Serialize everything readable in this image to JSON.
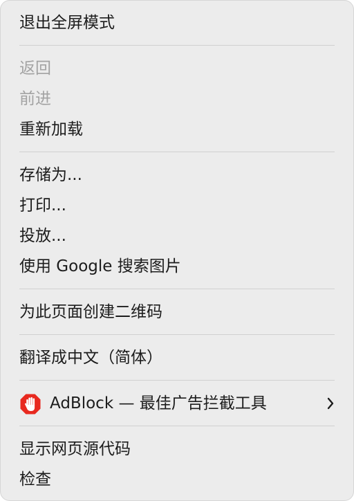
{
  "menu": {
    "group1": {
      "exit_fullscreen": "退出全屏模式"
    },
    "group2": {
      "back": "返回",
      "forward": "前进",
      "reload": "重新加载"
    },
    "group3": {
      "save_as": "存储为...",
      "print": "打印...",
      "cast": "投放...",
      "search_image": "使用 Google 搜索图片"
    },
    "group4": {
      "qr_code": "为此页面创建二维码"
    },
    "group5": {
      "translate": "翻译成中文（简体）"
    },
    "group6": {
      "adblock": "AdBlock — 最佳广告拦截工具",
      "adblock_icon": "adblock-hand-icon",
      "adblock_icon_color": "#e8291f",
      "submenu_icon": "chevron-right-icon"
    },
    "group7": {
      "view_source": "显示网页源代码",
      "inspect": "检查"
    }
  },
  "colors": {
    "background": "#ececec",
    "text": "#1c1c1c",
    "disabled_text": "#a3a3a3",
    "separator": "#d0d0d0"
  }
}
